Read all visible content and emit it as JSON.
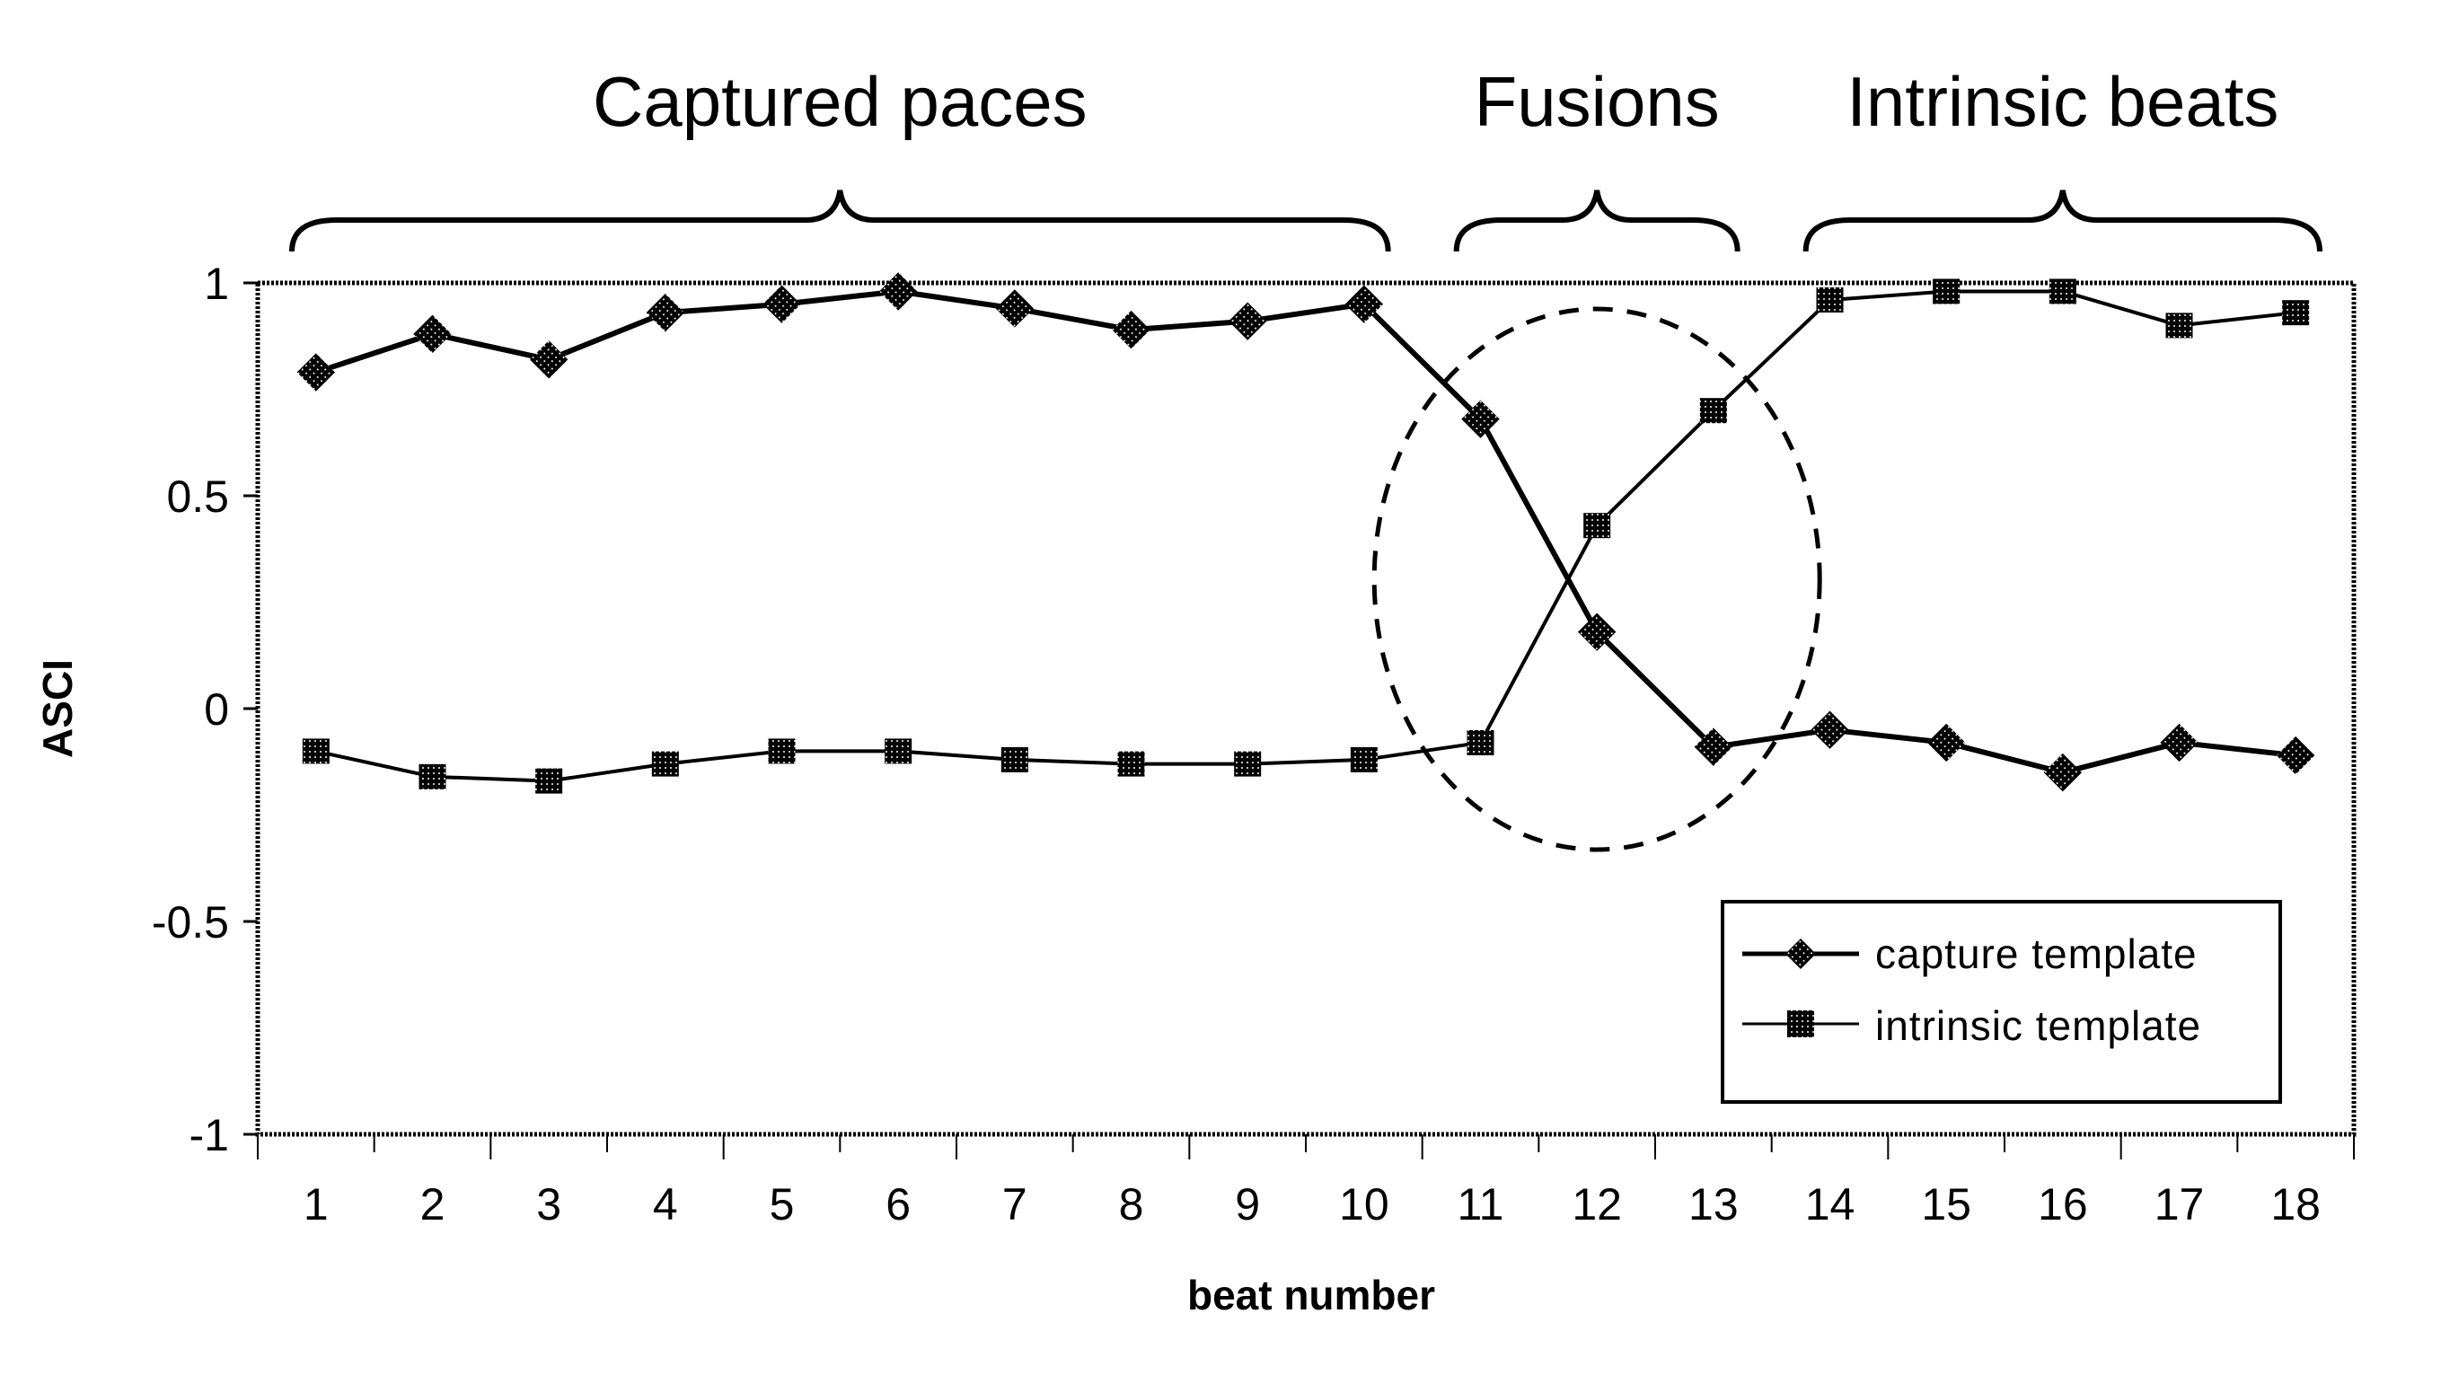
{
  "chart_data": {
    "type": "line",
    "title": "",
    "xlabel": "beat number",
    "ylabel": "ASCI",
    "x": [
      1,
      2,
      3,
      4,
      5,
      6,
      7,
      8,
      9,
      10,
      11,
      12,
      13,
      14,
      15,
      16,
      17,
      18
    ],
    "x_tick_labels": [
      "1",
      "2",
      "3",
      "4",
      "5",
      "6",
      "7",
      "8",
      "9",
      "10",
      "11",
      "12",
      "13",
      "14",
      "15",
      "16",
      "17",
      "18"
    ],
    "ylim": [
      -1,
      1
    ],
    "y_ticks": [
      1,
      0.5,
      0,
      -0.5,
      -1
    ],
    "y_tick_labels": [
      "1",
      "0.5",
      "0",
      "-0.5",
      "-1"
    ],
    "grid": false,
    "legend_position": "bottom-right",
    "series": [
      {
        "name": "capture template",
        "marker": "diamond",
        "values": [
          0.79,
          0.88,
          0.82,
          0.93,
          0.95,
          0.98,
          0.94,
          0.89,
          0.91,
          0.95,
          0.68,
          0.18,
          -0.09,
          -0.05,
          -0.08,
          -0.15,
          -0.08,
          -0.11
        ]
      },
      {
        "name": "intrinsic template",
        "marker": "square",
        "values": [
          -0.1,
          -0.16,
          -0.17,
          -0.13,
          -0.1,
          -0.1,
          -0.12,
          -0.13,
          -0.13,
          -0.12,
          -0.08,
          0.43,
          0.7,
          0.96,
          0.98,
          0.98,
          0.9,
          0.93
        ]
      }
    ],
    "annotations": [
      {
        "type": "brace",
        "label": "Captured paces",
        "from_beat": 1,
        "to_beat": 10
      },
      {
        "type": "brace",
        "label": "Fusions",
        "from_beat": 11,
        "to_beat": 13
      },
      {
        "type": "brace",
        "label": "Intrinsic beats",
        "from_beat": 14,
        "to_beat": 18
      },
      {
        "type": "dashed-ellipse",
        "label": "",
        "around_beats": [
          11,
          12,
          13
        ]
      }
    ]
  },
  "legend": {
    "items": [
      "capture template",
      "intrinsic template"
    ]
  }
}
